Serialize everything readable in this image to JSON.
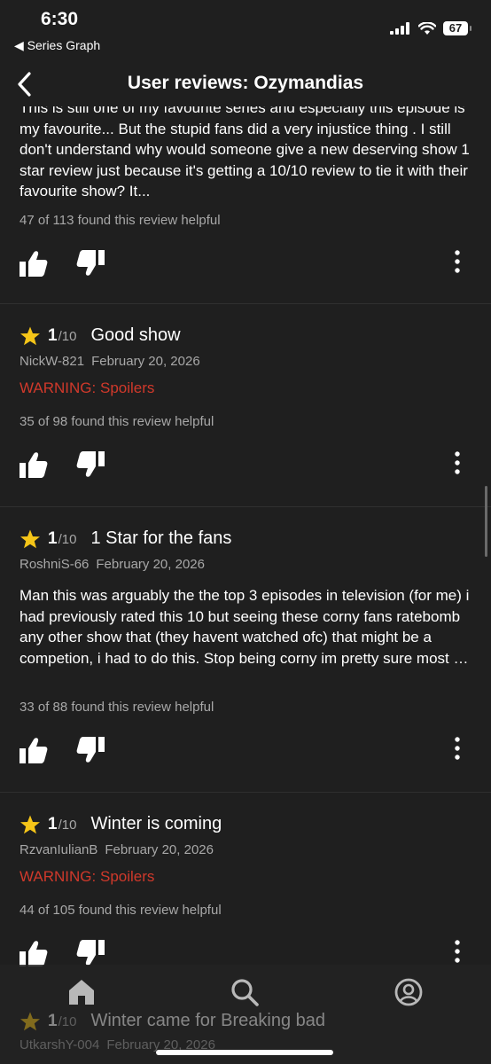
{
  "status_bar": {
    "time": "6:30",
    "back_app": "◀ Series Graph",
    "battery": "67"
  },
  "header": {
    "title": "User reviews: Ozymandias"
  },
  "reviews": [
    {
      "text": "This is still one of my favourite series and especially this episode is my favourite... But the stupid fans did a very injustice thing . I still don't understand why would someone give a new deserving show 1 star review just because it's getting a 10/10 review to tie it with their favourite show? It...",
      "helpful": "47 of 113 found this review helpful"
    },
    {
      "score": "1",
      "out_of": "/10",
      "title": "Good show",
      "author": "NickW-821",
      "date": "February 20, 2026",
      "warning": "WARNING: Spoilers",
      "helpful": "35 of 98 found this review helpful"
    },
    {
      "score": "1",
      "out_of": "/10",
      "title": "1 Star for the fans",
      "author": "RoshniS-66",
      "date": "February 20, 2026",
      "text": "Man this was arguably the the top 3 episodes in television (for me) i had previously rated this 10 but seeing these corny fans ratebomb any other show that (they havent watched ofc) that might be a competion, i had to do this. Stop being corny im pretty sure most of these pre teenag...",
      "helpful": "33 of 88 found this review helpful"
    },
    {
      "score": "1",
      "out_of": "/10",
      "title": "Winter is coming",
      "author": "RzvanIulianB",
      "date": "February 20, 2026",
      "warning": "WARNING: Spoilers",
      "helpful": "44 of 105 found this review helpful"
    },
    {
      "score": "1",
      "out_of": "/10",
      "title": "Winter came for Breaking bad",
      "author": "UtkarshY-004",
      "date": "February 20, 2026"
    }
  ],
  "tab_bar": {
    "items": [
      "home-icon",
      "search-icon",
      "profile-icon"
    ],
    "active": "home-icon"
  },
  "colors": {
    "background": "#1f1f1f",
    "star": "#f5c518",
    "warning": "#d0392b",
    "secondary_text": "#a8a8a8"
  }
}
